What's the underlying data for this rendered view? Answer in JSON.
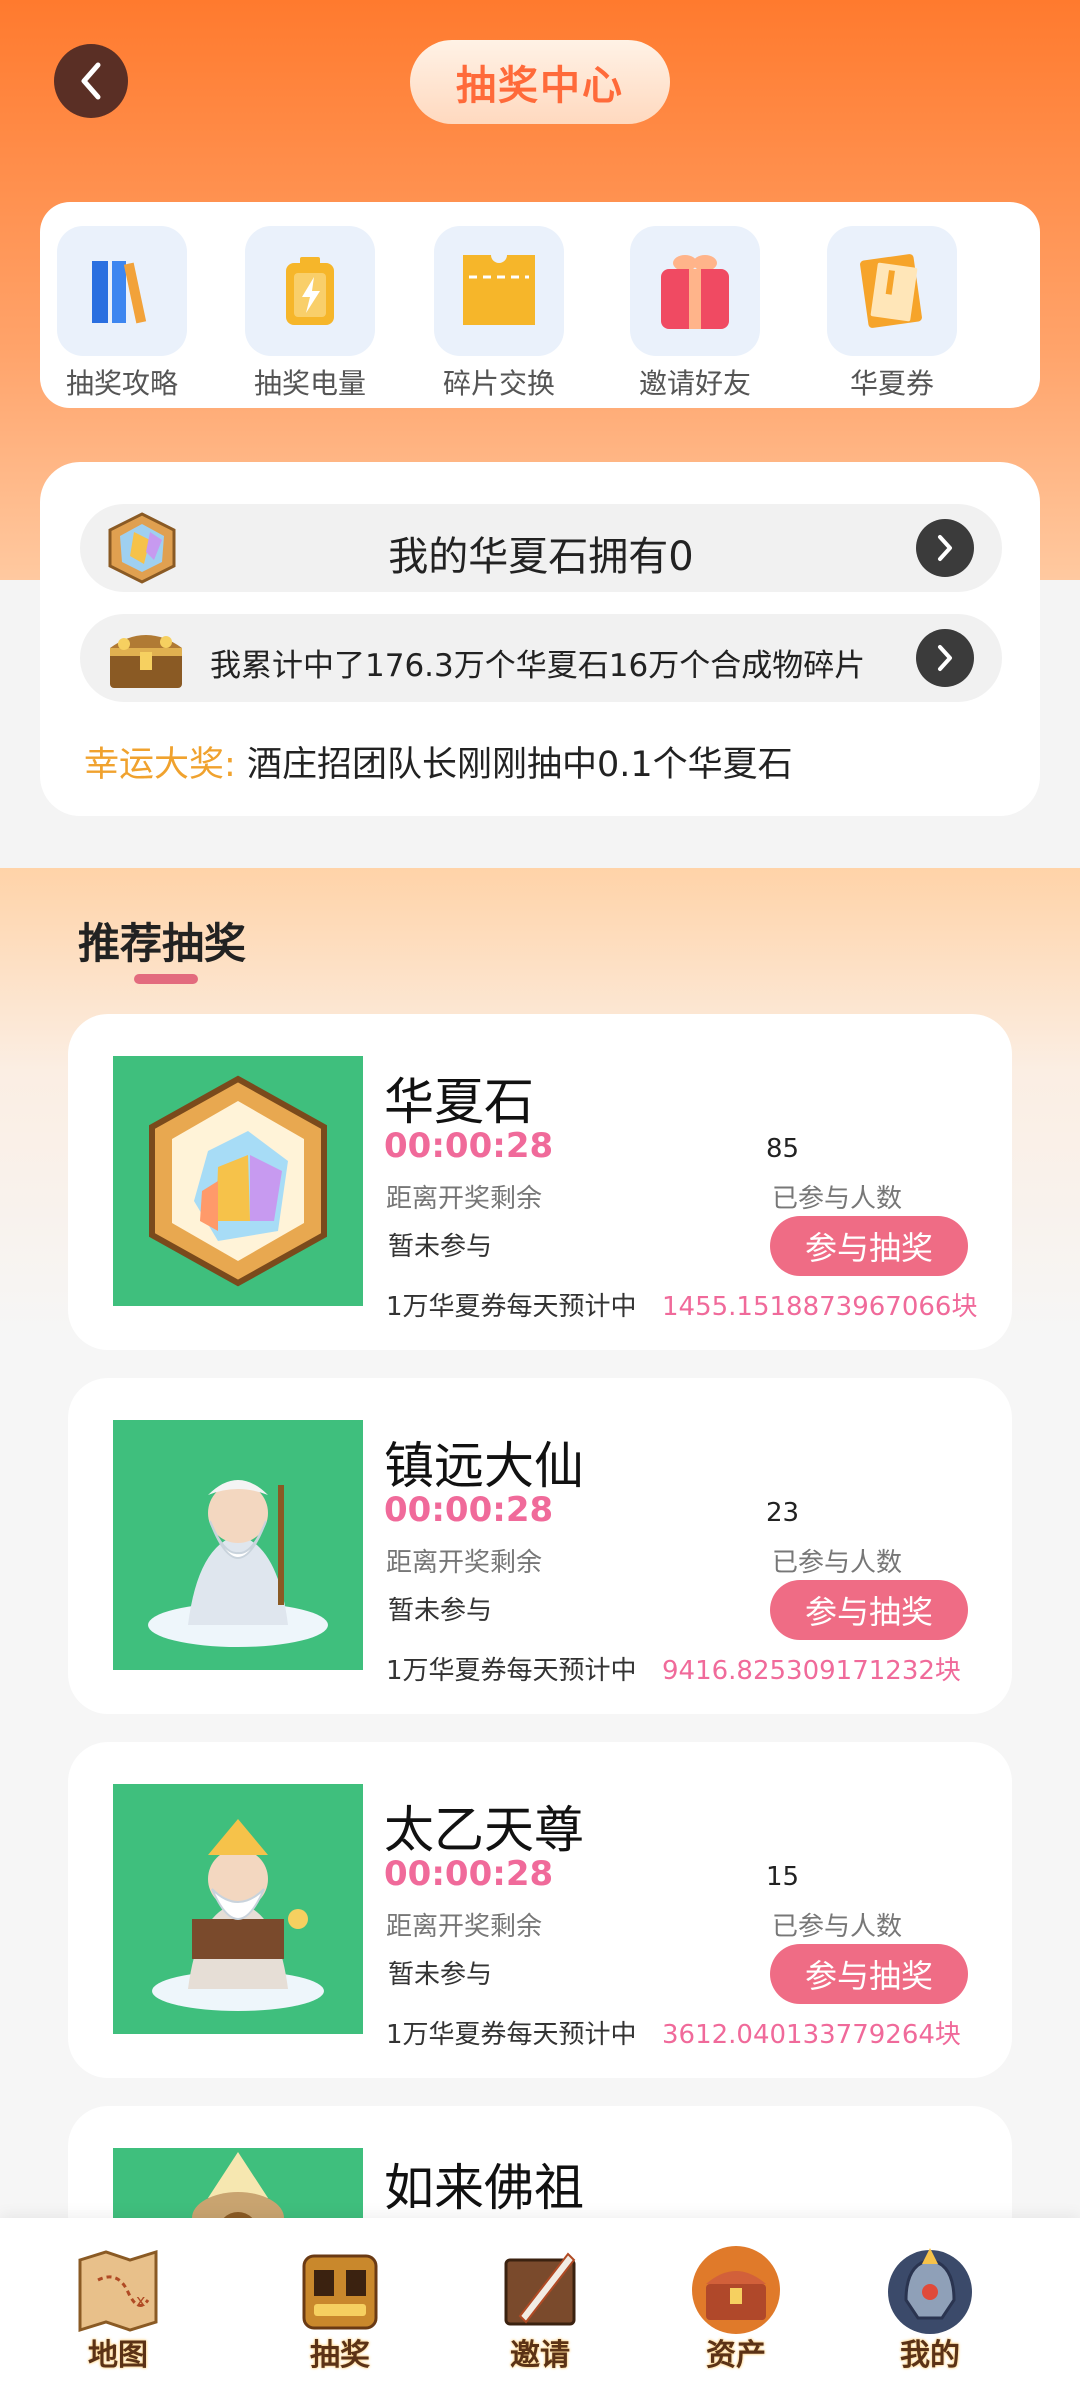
{
  "header": {
    "title": "抽奖中心"
  },
  "quick_links": [
    {
      "label": "抽奖攻略",
      "icon": "books-icon"
    },
    {
      "label": "抽奖电量",
      "icon": "battery-icon"
    },
    {
      "label": "碎片交换",
      "icon": "ticket-icon"
    },
    {
      "label": "邀请好友",
      "icon": "gift-icon"
    },
    {
      "label": "华夏券",
      "icon": "coupon-icon"
    }
  ],
  "info": {
    "stones_owned": "我的华夏石拥有0",
    "cumulative": "我累计中了176.3万个华夏石16万个合成物碎片",
    "lucky_label": "幸运大奖:",
    "lucky_text": "酒庄招团队长刚刚抽中0.1个华夏石"
  },
  "section": {
    "title": "推荐抽奖"
  },
  "common": {
    "timer_label": "距离开奖剩余",
    "status": "暂未参与",
    "count_label": "已参与人数",
    "join_label": "参与抽奖",
    "daily_label": "1万华夏券每天预计中"
  },
  "prizes": [
    {
      "name": "华夏石",
      "timer": "00:00:28",
      "count": "85",
      "daily_value": "1455.1518873967066块"
    },
    {
      "name": "镇远大仙",
      "timer": "00:00:28",
      "count": "23",
      "daily_value": "9416.825309171232块"
    },
    {
      "name": "太乙天尊",
      "timer": "00:00:28",
      "count": "15",
      "daily_value": "3612.040133779264块"
    },
    {
      "name": "如来佛祖"
    }
  ],
  "bottom_nav": [
    {
      "label": "地图",
      "icon": "map-icon"
    },
    {
      "label": "抽奖",
      "icon": "slot-machine-icon"
    },
    {
      "label": "邀请",
      "icon": "scroll-quill-icon"
    },
    {
      "label": "资产",
      "icon": "treasure-chest-icon"
    },
    {
      "label": "我的",
      "icon": "helmet-icon"
    }
  ],
  "colors": {
    "accent": "#ff7a2e",
    "pink": "#f06a9a",
    "join_button": "#ef6c85",
    "lucky": "#f0a22e",
    "card_image_bg": "#3fbf7d"
  }
}
